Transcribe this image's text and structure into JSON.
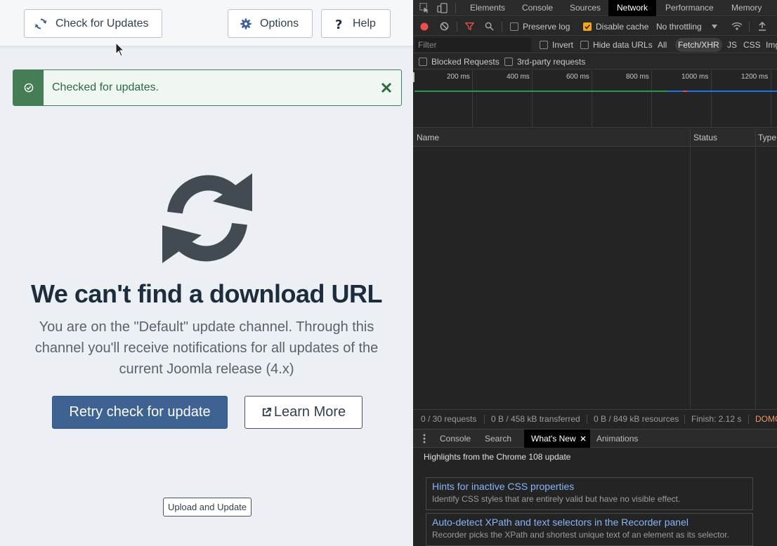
{
  "joomla": {
    "toolbar": {
      "check_label": "Check for Updates",
      "options_label": "Options",
      "help_label": "Help"
    },
    "alert": {
      "message": "Checked for updates."
    },
    "main": {
      "heading": "We can't find a download URL",
      "description": "You are on the \"Default\" update channel. Through this channel you'll receive notifications for all updates of the current Joomla release (4.x)",
      "retry_label": "Retry check for update",
      "learn_more_label": "Learn More",
      "upload_label": "Upload and Update"
    },
    "colors": {
      "primary": "#3e6292",
      "success": "#457d54",
      "icon": "#424a52"
    }
  },
  "devtools": {
    "tabs": [
      {
        "label": "Elements"
      },
      {
        "label": "Console"
      },
      {
        "label": "Sources"
      },
      {
        "label": "Network"
      },
      {
        "label": "Performance"
      },
      {
        "label": "Memory"
      }
    ],
    "active_tab": "Network",
    "toolbar": {
      "preserve_log": "Preserve log",
      "disable_cache": "Disable cache",
      "throttling": "No throttling"
    },
    "filter": {
      "placeholder": "Filter",
      "invert": "Invert",
      "hide_data_urls": "Hide data URLs",
      "types": [
        "All",
        "Fetch/XHR",
        "JS",
        "CSS",
        "Img"
      ]
    },
    "blocked": {
      "blocked_requests": "Blocked Requests",
      "third_party": "3rd-party requests"
    },
    "timeline": {
      "ticks": [
        "200 ms",
        "400 ms",
        "600 ms",
        "800 ms",
        "1000 ms",
        "1200 ms"
      ]
    },
    "table": {
      "columns": [
        "Name",
        "Status",
        "Type"
      ]
    },
    "status_bar": {
      "requests": "0 / 30 requests",
      "transferred": "0 B / 458 kB transferred",
      "resources": "0 B / 849 kB resources",
      "finish": "Finish: 2.12 s",
      "dom": "DOMC"
    },
    "drawer": {
      "tabs": [
        "Console",
        "Search",
        "What's New",
        "Animations"
      ],
      "active": "What's New",
      "highlights": "Highlights from the Chrome 108 update",
      "cards": [
        {
          "title": "Hints for inactive CSS properties",
          "desc": "Identify CSS styles that are entirely valid but have no visible effect."
        },
        {
          "title": "Auto-detect XPath and text selectors in the Recorder panel",
          "desc": "Recorder picks the XPath and shortest unique text of an element as its selector."
        }
      ]
    }
  }
}
